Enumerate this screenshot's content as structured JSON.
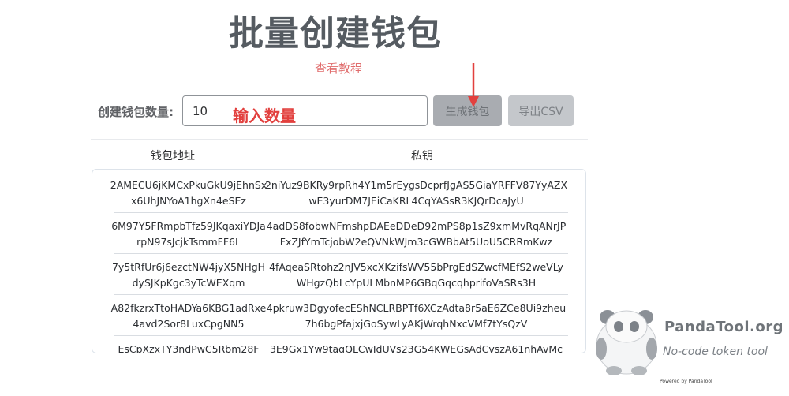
{
  "page": {
    "title": "批量创建钱包",
    "tutorial_link": "查看教程"
  },
  "form": {
    "count_label": "创建钱包数量:",
    "count_value": "10",
    "annotation": "输入数量",
    "generate_button": "生成钱包",
    "export_button": "导出CSV"
  },
  "table": {
    "headers": {
      "address": "钱包地址",
      "private_key": "私钥"
    },
    "rows": [
      {
        "address": "2AMECU6jKMCxPkuGkU9jEhnSxx6UhJNYoA1hgXn4eSEz",
        "private_key": "2niYuz9BKRy9rpRh4Y1m5rEygsDcprfJgAS5GiaYRFFV87YyAZXwE3yurDM7JEiCaKRL4CqYASsR3KJQrDcaJyU"
      },
      {
        "address": "6M97Y5FRmpbTfz59JKqaxiYDJarpN97sJcjkTsmmFF6L",
        "private_key": "4adDS8fobwNFmshpDAEeDDeD92mPS8p1sZ9xmMvRqANrJPFxZJfYmTcjobW2eQVNkWJm3cGWBbAt5UoU5CRRmKwz"
      },
      {
        "address": "7y5tRfUr6j6ezctNW4jyX5NHgHdySJKpKgc3yTcWEXqm",
        "private_key": "4fAqeaSRtohz2nJV5xcXKzifsWV55bPrgEdSZwcfMEfS2weVLyWHgzQbLcYpULMbnMP6GBqGqcqhprifoVaSRs3H"
      },
      {
        "address": "A82fkzrxTtoHADYa6KBG1adRxe4avd2Sor8LuxCpgNN5",
        "private_key": "4pkruw3DgyofecEShNCLRBPTf6XCzAdta8r5aE6ZCe8Ui9zheu7h6bgPfajxjGoSywLyAKjWrqhNxcVMf7tYsQzV"
      },
      {
        "address": "EsCpXzxTY3ndPwC5Rbm28F",
        "private_key": "3E9Gx1Yw9tagQLCwJdUVs23G54KWEGsAdCvszA61nhAvMc"
      }
    ]
  },
  "watermark": {
    "brand": "PandaTool.org",
    "tagline": "No-code token tool",
    "powered": "Powered by PandaTool"
  },
  "colors": {
    "annotation_red": "#e2403e",
    "link_red": "#e06c6c",
    "title_gray": "#555b61"
  }
}
